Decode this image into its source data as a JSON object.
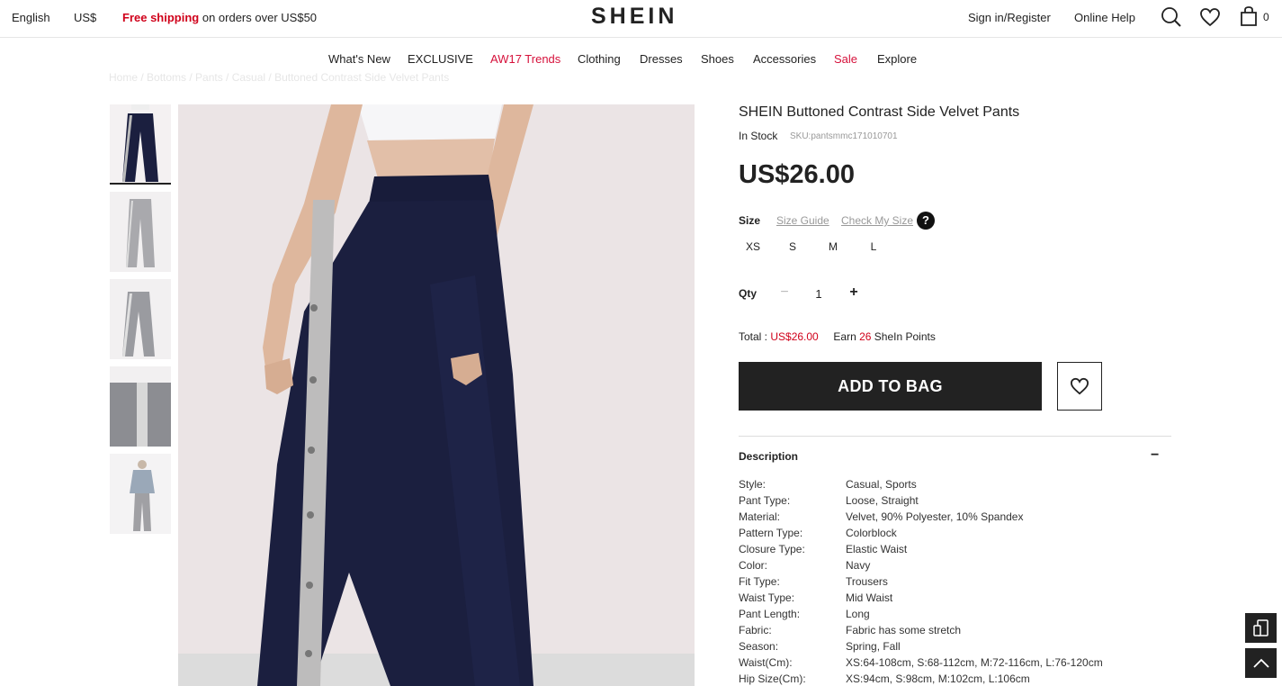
{
  "topbar": {
    "language": "English",
    "currency": "US$",
    "shipping_bold": "Free shipping",
    "shipping_rest": " on orders over US$50",
    "logo": "SHEIN",
    "sign_in": "Sign in/Register",
    "help": "Online Help",
    "bag_count": "0"
  },
  "nav": {
    "items": [
      "What's New",
      "EXCLUSIVE",
      "AW17 Trends",
      "Clothing",
      "Dresses",
      "Shoes",
      "Accessories",
      "Sale",
      "Explore"
    ]
  },
  "breadcrumb": "Home  /  Bottoms  /  Pants  /  Casual  /  Buttoned Contrast Side Velvet Pants",
  "product": {
    "title": "SHEIN Buttoned Contrast Side Velvet Pants",
    "stock": "In Stock",
    "sku": "SKU:pantsmmc171010701",
    "price": "US$26.00",
    "size_label": "Size",
    "size_guide": "Size Guide",
    "check_size": "Check My Size",
    "help_badge": "?",
    "sizes": [
      "XS",
      "S",
      "M",
      "L"
    ],
    "qty_label": "Qty",
    "qty_minus": "−",
    "qty_value": "1",
    "qty_plus": "+",
    "total_label": "Total : ",
    "total_value": "US$26.00",
    "earn_prefix": "Earn ",
    "earn_points": "26",
    "earn_suffix": " SheIn Points",
    "add_to_bag": "ADD TO BAG"
  },
  "description": {
    "title": "Description",
    "toggle": "−",
    "attributes": [
      {
        "key": "Style:",
        "value": "Casual, Sports"
      },
      {
        "key": "Pant Type:",
        "value": "Loose, Straight"
      },
      {
        "key": "Material:",
        "value": "Velvet, 90% Polyester, 10% Spandex"
      },
      {
        "key": "Pattern Type:",
        "value": "Colorblock"
      },
      {
        "key": "Closure Type:",
        "value": "Elastic Waist"
      },
      {
        "key": "Color:",
        "value": "Navy"
      },
      {
        "key": "Fit Type:",
        "value": "Trousers"
      },
      {
        "key": "Waist Type:",
        "value": "Mid Waist"
      },
      {
        "key": "Pant Length:",
        "value": "Long"
      },
      {
        "key": "Fabric:",
        "value": "Fabric has some stretch"
      },
      {
        "key": "Season:",
        "value": "Spring, Fall"
      },
      {
        "key": "Waist(Cm):",
        "value": "XS:64-108cm, S:68-112cm, M:72-116cm, L:76-120cm"
      },
      {
        "key": "Hip Size(Cm):",
        "value": "XS:94cm, S:98cm, M:102cm, L:106cm"
      }
    ]
  },
  "colors": {
    "accent_red": "#d0021b",
    "sale_pink": "#d6113b",
    "button_dark": "#222222",
    "pants_navy": "#1b1f3f"
  },
  "icons": [
    "search-icon",
    "heart-icon",
    "bag-icon",
    "help-icon",
    "wishlist-heart-icon",
    "device-icon",
    "arrow-up-icon"
  ]
}
